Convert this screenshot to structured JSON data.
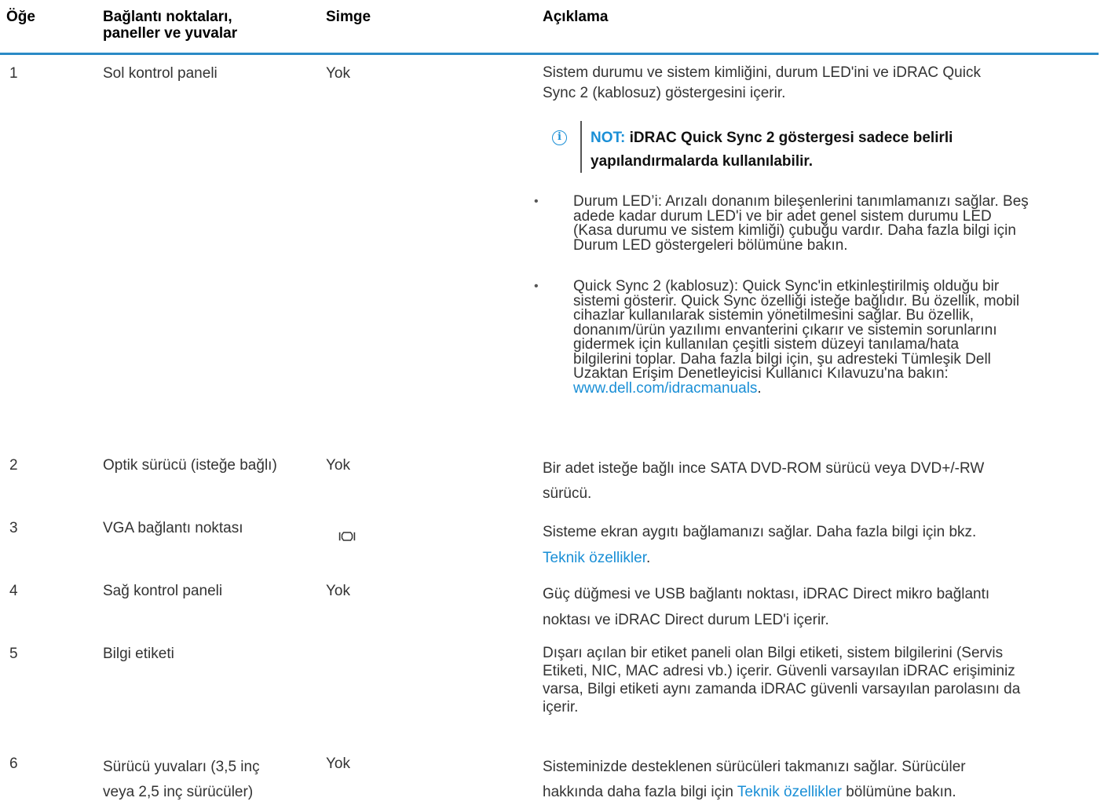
{
  "header": {
    "item": "Öğe",
    "ports_line1": "Bağlantı noktaları,",
    "ports_line2": "paneller ve yuvalar",
    "icon": "Simge",
    "description": "Açıklama"
  },
  "rows": [
    {
      "number": "1",
      "name": "Sol kontrol paneli",
      "icon": "Yok",
      "desc_line1": "Sistem durumu ve sistem kimliğini, durum LED'ini ve iDRAC Quick",
      "desc_line2": "Sync 2 (kablosuz) göstergesini içerir.",
      "note_label": "NOT:",
      "note_line1_rest": " iDRAC Quick Sync 2 göstergesi sadece belirli",
      "note_line2": "yapılandırmalarda kullanılabilir.",
      "bullets": [
        {
          "lines": [
            "Durum LED’i: Arızalı donanım bileşenlerini tanımlamanızı sağlar. Beş",
            "adede kadar durum LED'i ve bir adet genel sistem durumu LED",
            "(Kasa durumu ve sistem kimliği) çubuğu vardır. Daha fazla bilgi için",
            "Durum LED göstergeleri bölümüne bakın."
          ]
        },
        {
          "lines": [
            "Quick Sync 2 (kablosuz): Quick Sync'in etkinleştirilmiş olduğu bir",
            "sistemi gösterir. Quick Sync özelliği isteğe bağlıdır. Bu özellik, mobil",
            "cihazlar kullanılarak sistemin yönetilmesini sağlar. Bu özellik,",
            "donanım/ürün yazılımı envanterini çıkarır ve sistemin sorunlarını",
            "gidermek için kullanılan çeşitli sistem düzeyi tanılama/hata",
            "bilgilerini toplar. Daha fazla bilgi için, şu adresteki Tümleşik Dell",
            "Uzaktan Erişim Denetleyicisi Kullanıcı Kılavuzu'na bakın:"
          ],
          "link": "www.dell.com/idracmanuals",
          "after_link": "."
        }
      ]
    },
    {
      "number": "2",
      "name": "Optik sürücü (isteğe bağlı)",
      "icon": "Yok",
      "desc_line1": "Bir adet isteğe bağlı ince SATA DVD-ROM sürücü veya DVD+/-RW",
      "desc_line2": "sürücü."
    },
    {
      "number": "3",
      "name": "VGA bağlantı noktası",
      "icon_name": "vga-port-icon",
      "desc_line1": "Sisteme ekran aygıtı bağlamanızı sağlar. Daha fazla bilgi için bkz.",
      "desc_link": "Teknik özellikler",
      "desc_after_link": "."
    },
    {
      "number": "4",
      "name": "Sağ kontrol paneli",
      "icon": "Yok",
      "desc_line1": "Güç düğmesi ve USB bağlantı noktası, iDRAC Direct mikro bağlantı",
      "desc_line2": "noktası ve iDRAC Direct durum LED'i içerir."
    },
    {
      "number": "5",
      "name": "Bilgi etiketi",
      "desc_lines": [
        "Dışarı açılan bir etiket paneli olan Bilgi etiketi, sistem bilgilerini (Servis",
        "Etiketi, NIC, MAC adresi vb.) içerir. Güvenli varsayılan iDRAC erişiminiz",
        "varsa, Bilgi etiketi aynı zamanda iDRAC güvenli varsayılan parolasını da",
        "içerir."
      ]
    },
    {
      "number": "6",
      "name_line1": "Sürücü yuvaları (3,5 inç",
      "name_line2": "veya 2,5 inç sürücüler)",
      "icon": "Yok",
      "desc_line1": "Sisteminizde desteklenen sürücüleri takmanızı sağlar. Sürücüler",
      "desc_line2_before": "hakkında daha fazla bilgi için ",
      "desc_link": "Teknik özellikler",
      "desc_line2_after": " bölümüne bakın."
    }
  ],
  "colors": {
    "accent": "#2a8ac6",
    "link": "#1a8fd6",
    "text": "#333333"
  }
}
